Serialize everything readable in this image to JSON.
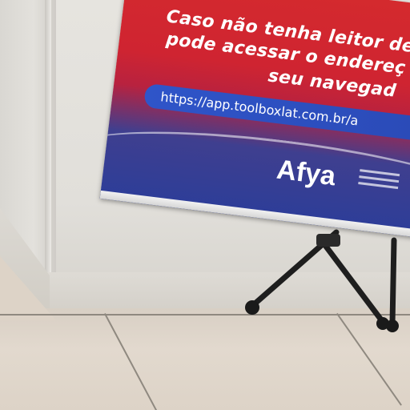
{
  "banner": {
    "line1": "Caso não tenha leitor de",
    "line2": "pode acessar o endereç",
    "line3": "seu navegad",
    "url": "https://app.toolboxlat.com.br/a",
    "brand": "Afya"
  },
  "colors": {
    "banner_red": "#d42a2e",
    "banner_blue": "#2c3d99",
    "url_pill": "#2f55c9",
    "wall": "#e3e1dc",
    "floor": "#ddd3c7",
    "stand": "#1e1e1e"
  }
}
